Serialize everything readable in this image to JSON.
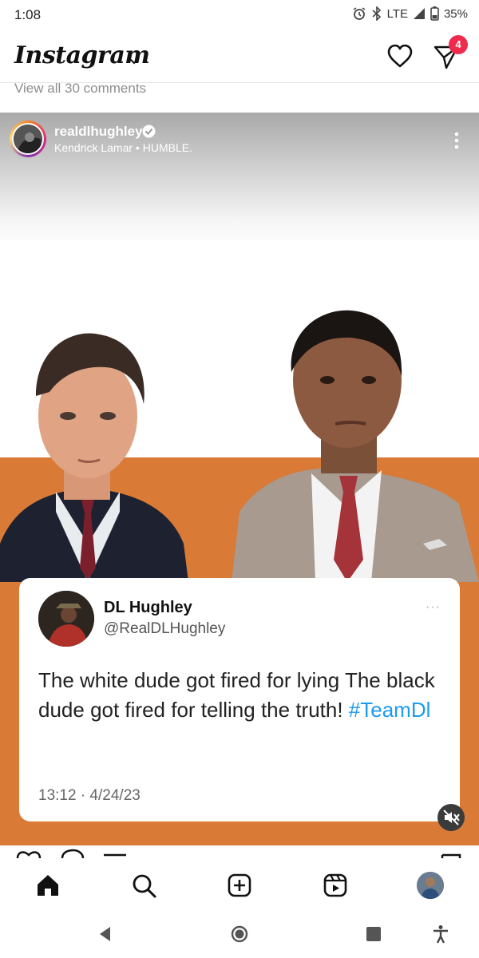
{
  "status_bar": {
    "time": "1:08",
    "network": "LTE",
    "battery": "35%"
  },
  "header": {
    "logo": "Instagram",
    "dm_badge_count": "4"
  },
  "comments_link": "View all 30 comments",
  "post": {
    "username": "realdlhughley",
    "music": "Kendrick Lamar • HUMBLE."
  },
  "tweet": {
    "name": "DL Hughley",
    "handle": "@RealDLHughley",
    "more": "···",
    "text_main": "The white dude got fired for lying The black dude got fired for telling the truth! ",
    "hashtag": "#TeamDl",
    "timestamp": "13:12 · 4/24/23"
  },
  "icons": {
    "status": [
      "alarm-icon",
      "bluetooth-icon",
      "signal-icon",
      "battery-icon"
    ],
    "header": [
      "chevron-down-icon",
      "heart-icon",
      "direct-message-icon"
    ],
    "post": [
      "verified-icon",
      "more-icon",
      "mute-icon"
    ],
    "bottom_nav": [
      "home-icon",
      "search-icon",
      "create-icon",
      "reels-icon",
      "profile-avatar"
    ],
    "system_nav": [
      "back-icon",
      "home-circle-icon",
      "recents-icon",
      "accessibility-icon"
    ]
  },
  "colors": {
    "instagram_badge": "#ee2b4d",
    "post_background": "#d97a36",
    "hashtag": "#1d9bf0"
  }
}
